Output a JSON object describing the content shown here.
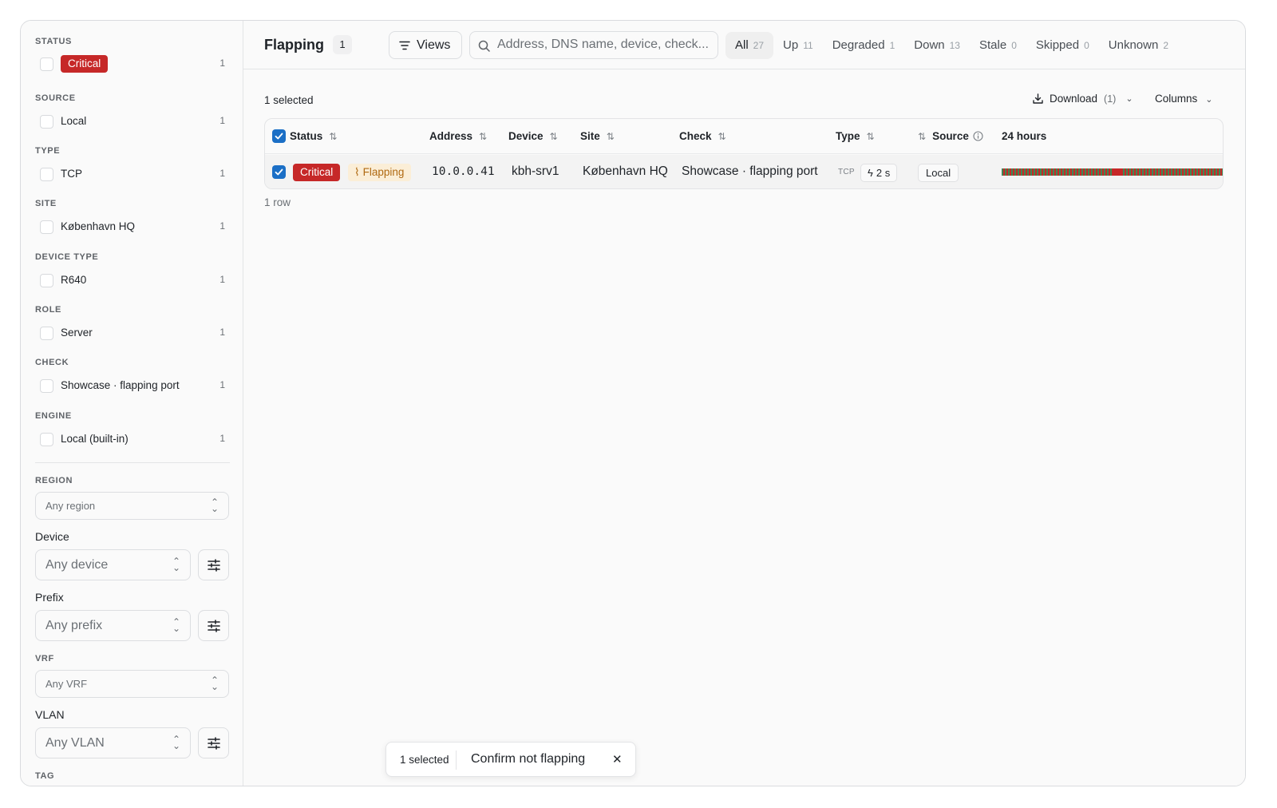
{
  "sidebar": {
    "facets": [
      {
        "title": "STATUS",
        "label": "Critical",
        "count": "1"
      },
      {
        "title": "SOURCE",
        "label": "Local",
        "count": "1"
      },
      {
        "title": "TYPE",
        "label": "TCP",
        "count": "1"
      },
      {
        "title": "SITE",
        "label": "København HQ",
        "count": "1"
      },
      {
        "title": "DEVICE TYPE",
        "label": "R640",
        "count": "1"
      },
      {
        "title": "ROLE",
        "label": "Server",
        "count": "1"
      },
      {
        "title": "CHECK",
        "label": "Showcase · flapping port",
        "count": "1"
      },
      {
        "title": "ENGINE",
        "label": "Local (built-in)",
        "count": "1"
      }
    ],
    "region": {
      "label": "REGION",
      "placeholder": "Any region"
    },
    "device": {
      "label": "Device",
      "placeholder": "Any device"
    },
    "prefix": {
      "label": "Prefix",
      "placeholder": "Any prefix"
    },
    "vrf": {
      "label": "VRF",
      "placeholder": "Any VRF"
    },
    "vlan": {
      "label": "VLAN",
      "placeholder": "Any VLAN"
    },
    "tag": {
      "label": "TAG"
    }
  },
  "header": {
    "title": "Flapping",
    "title_count": "1",
    "views_label": "Views",
    "search_placeholder": "Address, DNS name, device, check...",
    "tabs": [
      {
        "label": "All",
        "count": "27",
        "active": true
      },
      {
        "label": "Up",
        "count": "11"
      },
      {
        "label": "Degraded",
        "count": "1"
      },
      {
        "label": "Down",
        "count": "13"
      },
      {
        "label": "Stale",
        "count": "0"
      },
      {
        "label": "Skipped",
        "count": "0"
      },
      {
        "label": "Unknown",
        "count": "2"
      }
    ]
  },
  "toolbar": {
    "selected_text": "1 selected",
    "download_label": "Download",
    "download_count": "(1)",
    "columns_label": "Columns"
  },
  "table": {
    "columns": {
      "status": "Status",
      "address": "Address",
      "device": "Device",
      "site": "Site",
      "check": "Check",
      "type": "Type",
      "source": "Source",
      "history": "24 hours"
    },
    "rows": [
      {
        "status": "Critical",
        "flag": "Flapping",
        "address": "10.0.0.41",
        "device": "kbh-srv1",
        "site": "København HQ",
        "check": "Showcase · flapping port",
        "type": "TCP",
        "interval": "2 s",
        "source": "Local"
      }
    ],
    "row_count": "1 row"
  },
  "actionbar": {
    "selected": "1 selected",
    "confirm_label": "Confirm not flapping",
    "close_glyph": "✕"
  },
  "colors": {
    "critical": "#c62828",
    "flapping_bg": "#fbeed7",
    "flapping_fg": "#b06a12",
    "check_blue": "#1b6fc6",
    "history_up": "#3f8a55"
  }
}
